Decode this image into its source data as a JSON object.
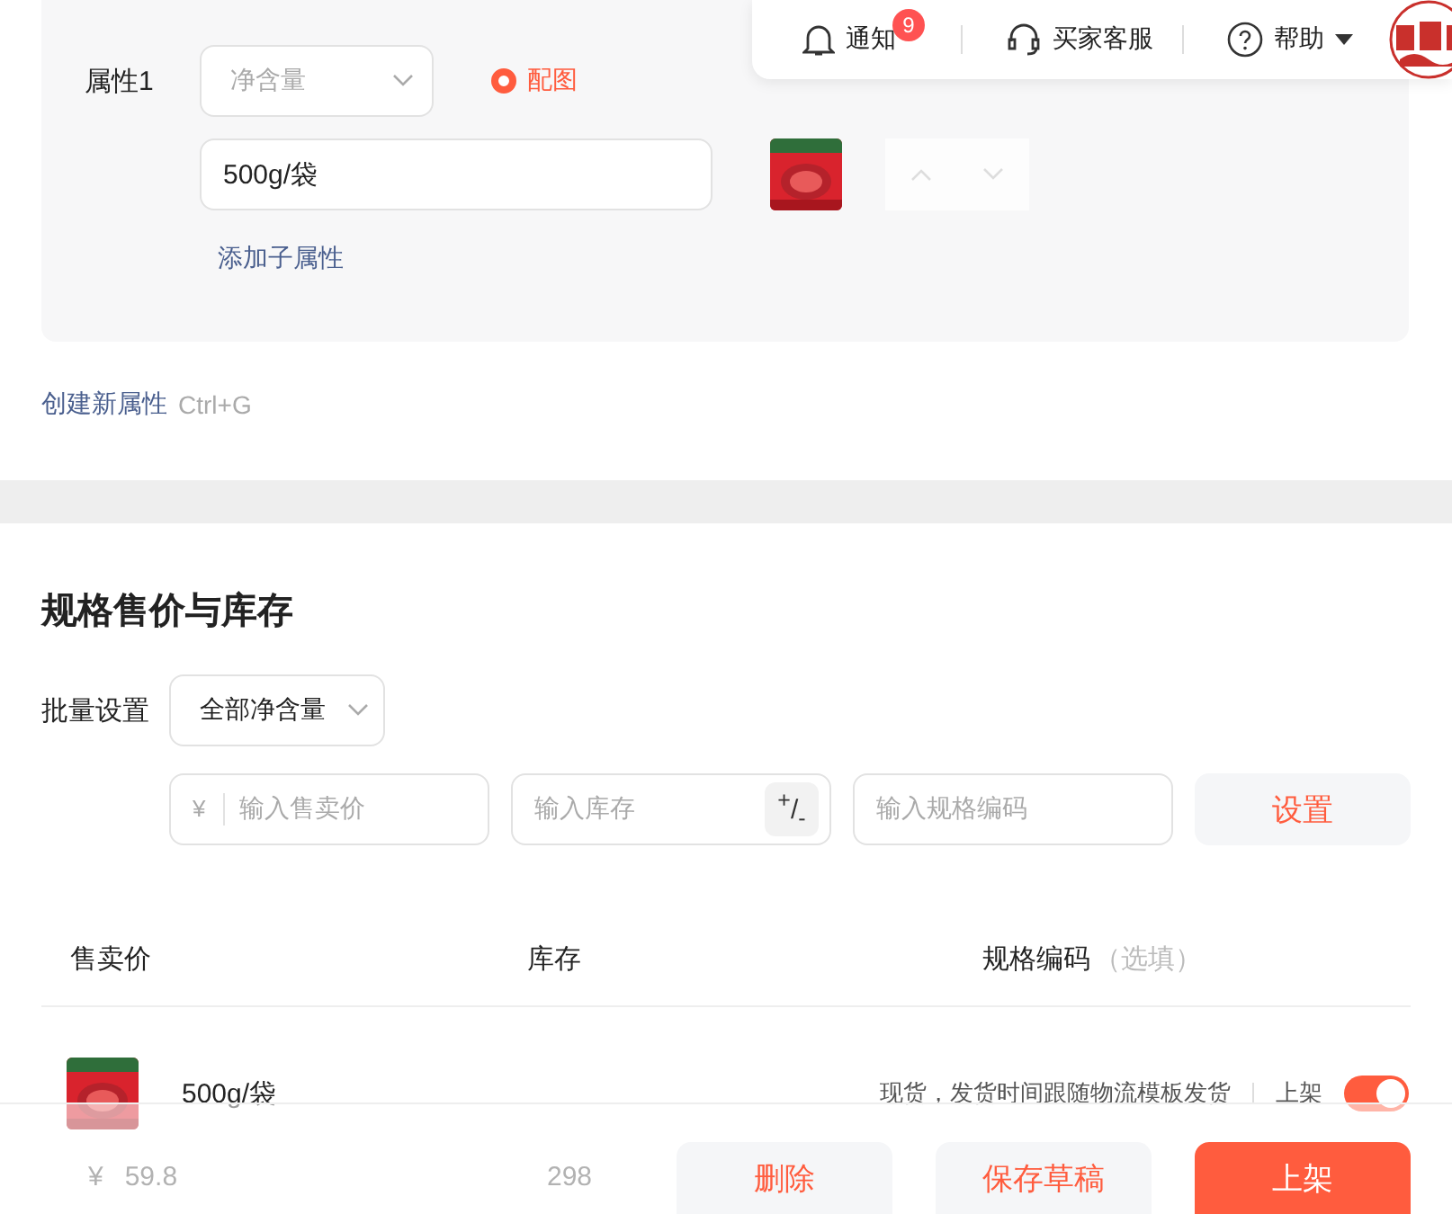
{
  "header": {
    "items": [
      {
        "kind": "bell",
        "label": "通知",
        "badge": "9"
      },
      {
        "kind": "headset",
        "label": "买家客服"
      },
      {
        "kind": "help",
        "label": "帮助"
      }
    ]
  },
  "attribute": {
    "label": "属性1",
    "name_select": {
      "placeholder": "净含量"
    },
    "image_option": {
      "label": "配图",
      "checked": true
    },
    "values": [
      {
        "value": "500g/袋",
        "up_disabled": true,
        "down_disabled": true
      }
    ],
    "add_sub_link": "添加子属性"
  },
  "create_attribute": {
    "link": "创建新属性",
    "shortcut": "Ctrl+G"
  },
  "pricing": {
    "title": "规格售价与库存",
    "batch": {
      "label": "批量设置",
      "select": "全部净含量",
      "fields": [
        {
          "kind": "price",
          "prefix": "¥",
          "placeholder": "输入售卖价"
        },
        {
          "kind": "stock",
          "placeholder": "输入库存",
          "sign_button": "$^{+}$/$_{-}$"
        },
        {
          "kind": "code",
          "placeholder": "输入规格编码"
        }
      ],
      "apply_button": "设置"
    },
    "table": {
      "columns": [
        {
          "label": "售卖价"
        },
        {
          "label": "库存"
        },
        {
          "label": "规格编码",
          "hint": "（选填）"
        }
      ],
      "rows": [
        {
          "variant": "500g/袋",
          "delivery": "现货，发货时间跟随物流模板发货",
          "listing_label": "上架",
          "listed": true,
          "currency": "¥",
          "price": "59.8",
          "stock": "298"
        }
      ]
    }
  },
  "footer": {
    "buttons": [
      {
        "label": "删除",
        "kind": "secondary"
      },
      {
        "label": "保存草稿",
        "kind": "secondary"
      },
      {
        "label": "上架",
        "kind": "primary"
      }
    ]
  }
}
